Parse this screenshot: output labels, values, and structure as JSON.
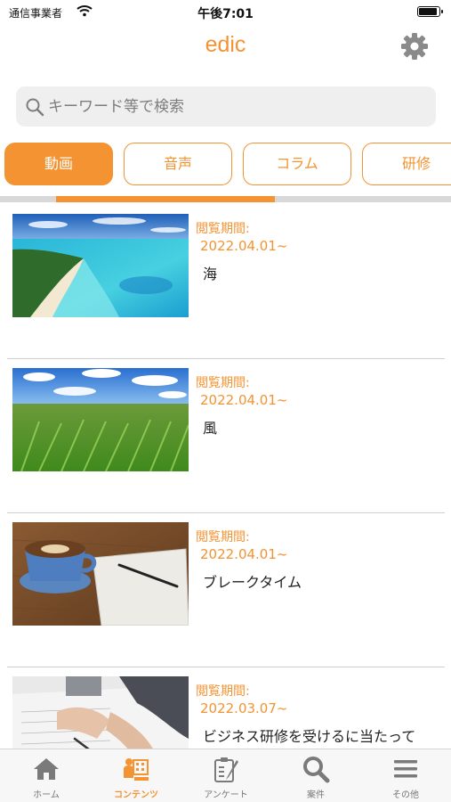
{
  "status_bar": {
    "carrier": "通信事業者",
    "time": "午後7:01",
    "wifi_icon": "wifi-icon",
    "battery_icon": "battery-icon",
    "battery_level": 0.95
  },
  "header": {
    "title": "edic",
    "settings_icon": "gear-icon"
  },
  "search": {
    "placeholder": "キーワード等で検索",
    "icon": "search-icon"
  },
  "category_tabs": [
    {
      "label": "動画",
      "active": true
    },
    {
      "label": "音声",
      "active": false
    },
    {
      "label": "コラム",
      "active": false
    },
    {
      "label": "研修",
      "active": false
    }
  ],
  "content_list": [
    {
      "period_label": "閲覧期間:",
      "period": "2022.04.01~",
      "title": "海",
      "thumbnail": "beach-image"
    },
    {
      "period_label": "閲覧期間:",
      "period": "2022.04.01~",
      "title": "風",
      "thumbnail": "wheat-field-image"
    },
    {
      "period_label": "閲覧期間:",
      "period": "2022.04.01~",
      "title": "ブレークタイム",
      "thumbnail": "coffee-notebook-image"
    },
    {
      "period_label": "閲覧期間:",
      "period": "2022.03.07~",
      "title": "ビジネス研修を受けるに当たって",
      "thumbnail": "business-meeting-image"
    }
  ],
  "tab_bar": [
    {
      "label": "ホーム",
      "icon": "home-icon",
      "active": false
    },
    {
      "label": "コンテンツ",
      "icon": "contents-icon",
      "active": true
    },
    {
      "label": "アンケート",
      "icon": "survey-icon",
      "active": false
    },
    {
      "label": "案件",
      "icon": "search-case-icon",
      "active": false
    },
    {
      "label": "その他",
      "icon": "menu-icon",
      "active": false
    }
  ],
  "colors": {
    "accent": "#f39332",
    "search_bg": "#efefef",
    "tabbar_bg": "#f7f7f7"
  }
}
